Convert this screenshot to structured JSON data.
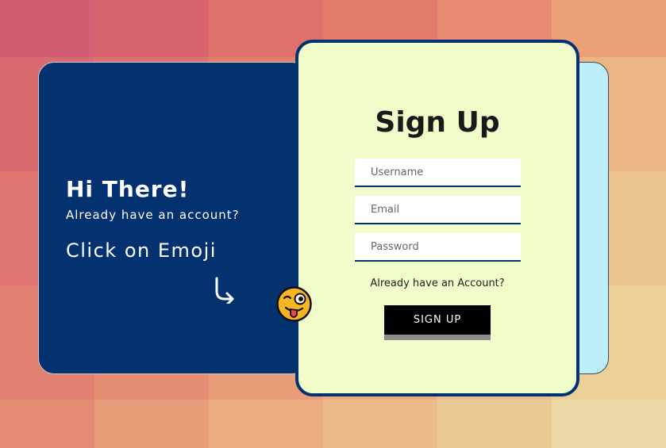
{
  "background": {
    "rows": [
      [
        "#d35d73",
        "#d8636d",
        "#df716d",
        "#e37b6d",
        "#e88b72",
        "#eba07a"
      ],
      [
        "#d96a70",
        "#dd736e",
        "#e47f6c",
        "#e88b70",
        "#eba27a",
        "#ecb684"
      ],
      [
        "#de7570",
        "#e1806f",
        "#e78e73",
        "#eaa07a",
        "#ebb585",
        "#ecc490"
      ],
      [
        "#e18071",
        "#e48d73",
        "#e89c78",
        "#ebac7f",
        "#ecc08b",
        "#ecd09a"
      ],
      [
        "#e58b74",
        "#e89c79",
        "#eaac80",
        "#ebbb88",
        "#ecc893",
        "#ecd9a6"
      ]
    ]
  },
  "left_panel": {
    "title": "Hi There!",
    "subtitle": "Already have an account?",
    "cta": "Click on Emoji",
    "arrow_icon": "arrow-turn-down-right-icon"
  },
  "signup_form": {
    "heading": "Sign Up",
    "fields": {
      "username_placeholder": "Username",
      "email_placeholder": "Email",
      "password_placeholder": "Password"
    },
    "already_link": "Already have an Account?",
    "submit_label": "SIGN UP"
  },
  "emoji_icon": "winking-tongue-face-icon",
  "colors": {
    "panel_navy": "#04316f",
    "card_bg": "#f1fccb",
    "back_panel": "#bdeefc",
    "button": "#000000",
    "emoji_yellow": "#f6b522"
  }
}
